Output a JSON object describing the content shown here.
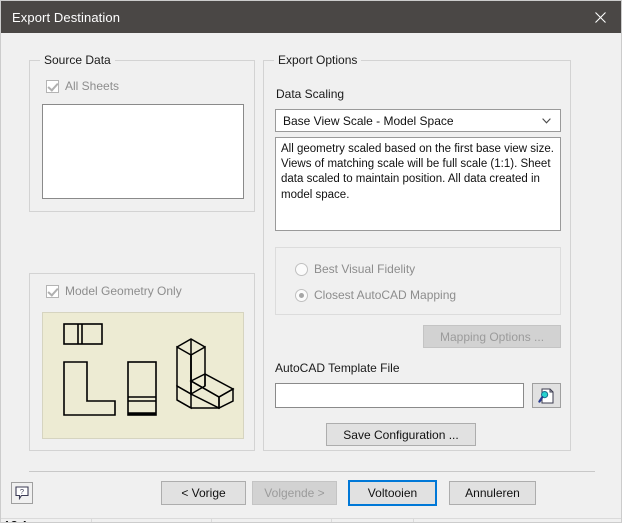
{
  "window": {
    "title": "Export Destination",
    "close_icon": "close-icon"
  },
  "source_data": {
    "group_label": "Source Data",
    "all_sheets_label": "All Sheets",
    "all_sheets_checked": true,
    "all_sheets_enabled": false
  },
  "model_geometry": {
    "group_label": "",
    "checkbox_label": "Model Geometry Only",
    "checked": true,
    "enabled": false,
    "preview_background": "#EDEBD3",
    "preview_items": [
      "top-view-drawing",
      "front-view-l-shape-drawing",
      "side-view-drawing",
      "isometric-view-drawing"
    ]
  },
  "export_options": {
    "group_label": "Export Options",
    "data_scaling_label": "Data Scaling",
    "data_scaling_selected": "Base View Scale - Model Space",
    "data_scaling_options": [
      "Base View Scale - Model Space"
    ],
    "description": "All geometry scaled based on the first base view size. Views of matching scale will be full scale (1:1). Sheet data scaled to maintain position. All data created in model space.",
    "fidelity_options": [
      {
        "label": "Best Visual Fidelity",
        "selected": false,
        "enabled": false
      },
      {
        "label": "Closest AutoCAD Mapping",
        "selected": true,
        "enabled": false
      }
    ],
    "mapping_options_label": "Mapping Options ...",
    "mapping_options_enabled": false,
    "template_file_label": "AutoCAD Template File",
    "template_file_value": "",
    "template_file_placeholder": "",
    "browse_icon": "document-search-icon",
    "save_configuration_label": "Save Configuration ..."
  },
  "footer": {
    "help_icon": "help-question-icon",
    "buttons": [
      {
        "label": "< Vorige",
        "enabled": true,
        "default": false
      },
      {
        "label": "Volgende >",
        "enabled": false,
        "default": false
      },
      {
        "label": "Voltooien",
        "enabled": true,
        "default": true
      },
      {
        "label": "Annuleren",
        "enabled": true,
        "default": false
      }
    ]
  },
  "colors": {
    "titlebar": "#4A4745",
    "dialog_background": "#F0F0F0",
    "accent_focus": "#0078D7",
    "preview_background": "#EDEBD3"
  }
}
